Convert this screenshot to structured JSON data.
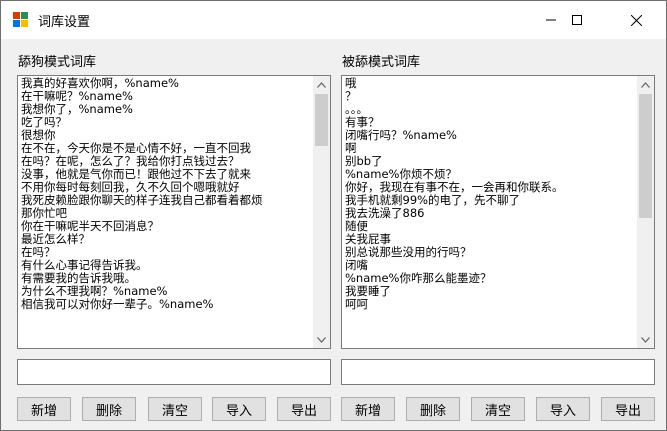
{
  "window": {
    "title": "词库设置"
  },
  "titlebar": {
    "minimize_icon": "minimize-icon",
    "maximize_icon": "maximize-icon",
    "close_icon": "close-icon"
  },
  "colors": {
    "icon_red": "#d83b01",
    "icon_blue": "#0078d7",
    "icon_yellow": "#ffb900",
    "icon_green": "#2e8b57",
    "scroll_thumb": "#cdcdcd"
  },
  "left_panel": {
    "label": "舔狗模式词库",
    "items": [
      "我真的好喜欢你啊，%name%",
      "在干嘛呢？%name%",
      "我想你了，%name%",
      "吃了吗？",
      "很想你",
      "在不在，今天你是不是心情不好，一直不回我",
      "在吗？在呢，怎么了？我给你打点钱过去？",
      "没事，他就是气你而已！跟他过不下去了就来",
      "不用你每时每刻回我，久不久回个嗯哦就好",
      "我死皮赖脸跟你聊天的样子连我自己都看着都烦",
      "那你忙吧",
      "你在干嘛呢半天不回消息？",
      "最近怎么样？",
      "在吗？",
      "有什么心事记得告诉我。",
      "有需要我的告诉我哦。",
      "为什么不理我啊？%name%",
      "相信我可以对你好一辈子。%name%"
    ],
    "input_value": "",
    "buttons": {
      "add": "新增",
      "delete": "删除",
      "clear": "清空",
      "import": "导入",
      "export": "导出"
    }
  },
  "right_panel": {
    "label": "被舔模式词库",
    "items": [
      "哦",
      "？",
      "。。。",
      "有事？",
      "闭嘴行吗？%name%",
      "啊",
      "别bb了",
      "%name%你烦不烦？",
      "你好，我现在有事不在，一会再和你联系。",
      "我手机就剩99%的电了，先不聊了",
      "我去洗澡了886",
      "随便",
      "关我屁事",
      "别总说那些没用的行吗？",
      "闭嘴",
      "%name%你咋那么能墨迹？",
      "我要睡了",
      "呵呵"
    ],
    "input_value": "",
    "buttons": {
      "add": "新增",
      "delete": "删除",
      "clear": "清空",
      "import": "导入",
      "export": "导出"
    }
  }
}
